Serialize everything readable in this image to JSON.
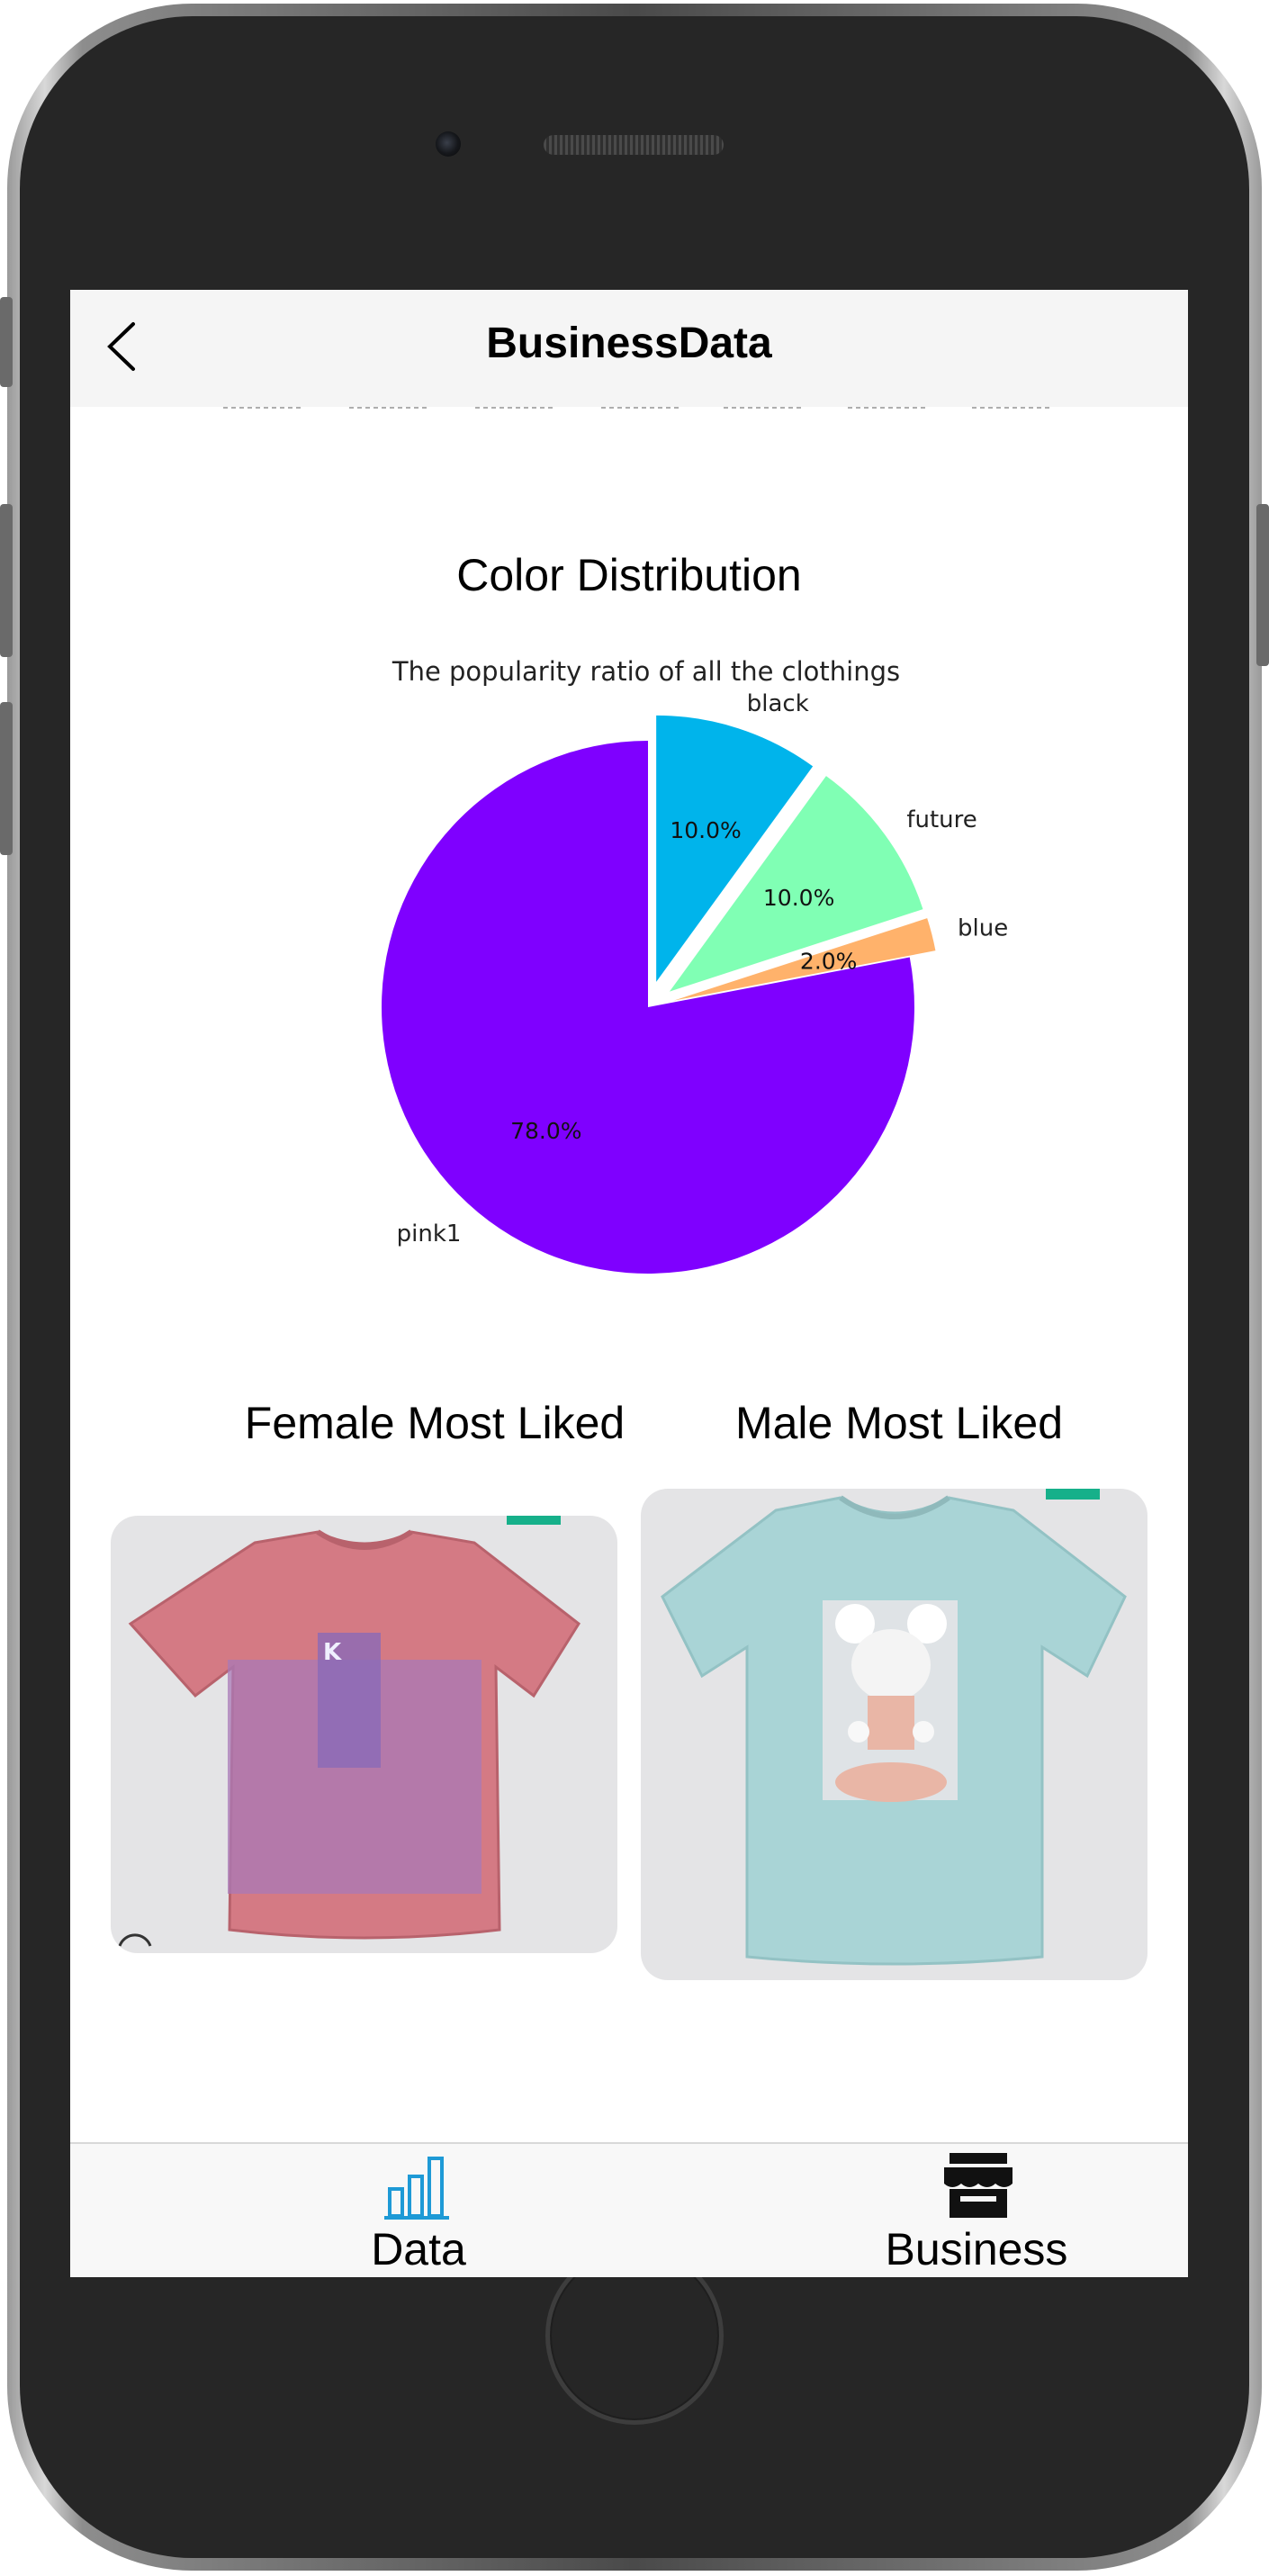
{
  "header": {
    "title": "BusinessData"
  },
  "color_section": {
    "title": "Color Distribution"
  },
  "chart_data": {
    "type": "pie",
    "title": "The popularity ratio of all the clothings",
    "slices": [
      {
        "label": "pink1",
        "value": 78.0,
        "display": "78.0%",
        "color": "#7f00ff",
        "exploded": false
      },
      {
        "label": "blue",
        "value": 2.0,
        "display": "2.0%",
        "color": "#ffb26b",
        "exploded": true
      },
      {
        "label": "future",
        "value": 10.0,
        "display": "10.0%",
        "color": "#80ffb4",
        "exploded": true
      },
      {
        "label": "black",
        "value": 10.0,
        "display": "10.0%",
        "color": "#00b4eb",
        "exploded": true
      }
    ]
  },
  "female": {
    "title": "Female Most Liked"
  },
  "male": {
    "title": "Male Most Liked"
  },
  "tabbar": {
    "data_label": "Data",
    "business_label": "Business",
    "active_color": "#1e9ad6"
  }
}
